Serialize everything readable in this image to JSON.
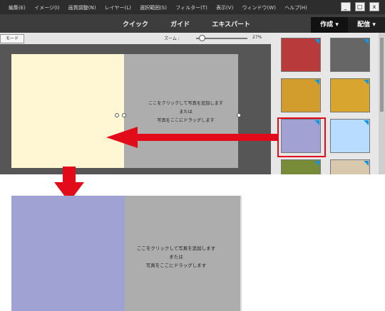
{
  "menu": [
    "編集(E)",
    "イメージ(I)",
    "画質調整(N)",
    "レイヤー(L)",
    "選択範囲(S)",
    "フィルター(T)",
    "表示(V)",
    "ウィンドウ(W)",
    "ヘルプ(H)"
  ],
  "window_controls": [
    "_",
    "□",
    "x"
  ],
  "modes": [
    "クイック",
    "ガイド",
    "エキスパート"
  ],
  "right_tabs": [
    "作成",
    "配信"
  ],
  "tab_dropdown": "▾",
  "mode_button": "モード",
  "zoom": {
    "label": "ズーム :",
    "value": "27%",
    "level_percent": 27
  },
  "placeholder": [
    "ここをクリックして写真を追加します",
    "または",
    "写真をここにドラッグします"
  ],
  "swatches": [
    {
      "name": "red",
      "color": "#b93a3b"
    },
    {
      "name": "gray",
      "color": "#666666"
    },
    {
      "name": "gold",
      "color": "#d29d2c"
    },
    {
      "name": "amber",
      "color": "#d8a62e"
    },
    {
      "name": "lavender",
      "color": "#a1a1d4"
    },
    {
      "name": "light-blue",
      "color": "#b7dcff"
    },
    {
      "name": "olive",
      "color": "#778b39"
    },
    {
      "name": "beige",
      "color": "#d8c8ae"
    }
  ],
  "colors": {
    "arrow": "#e10b19",
    "selection": "#e10b19",
    "lavender": "#a1a2d4",
    "cream": "#fff7d4"
  }
}
